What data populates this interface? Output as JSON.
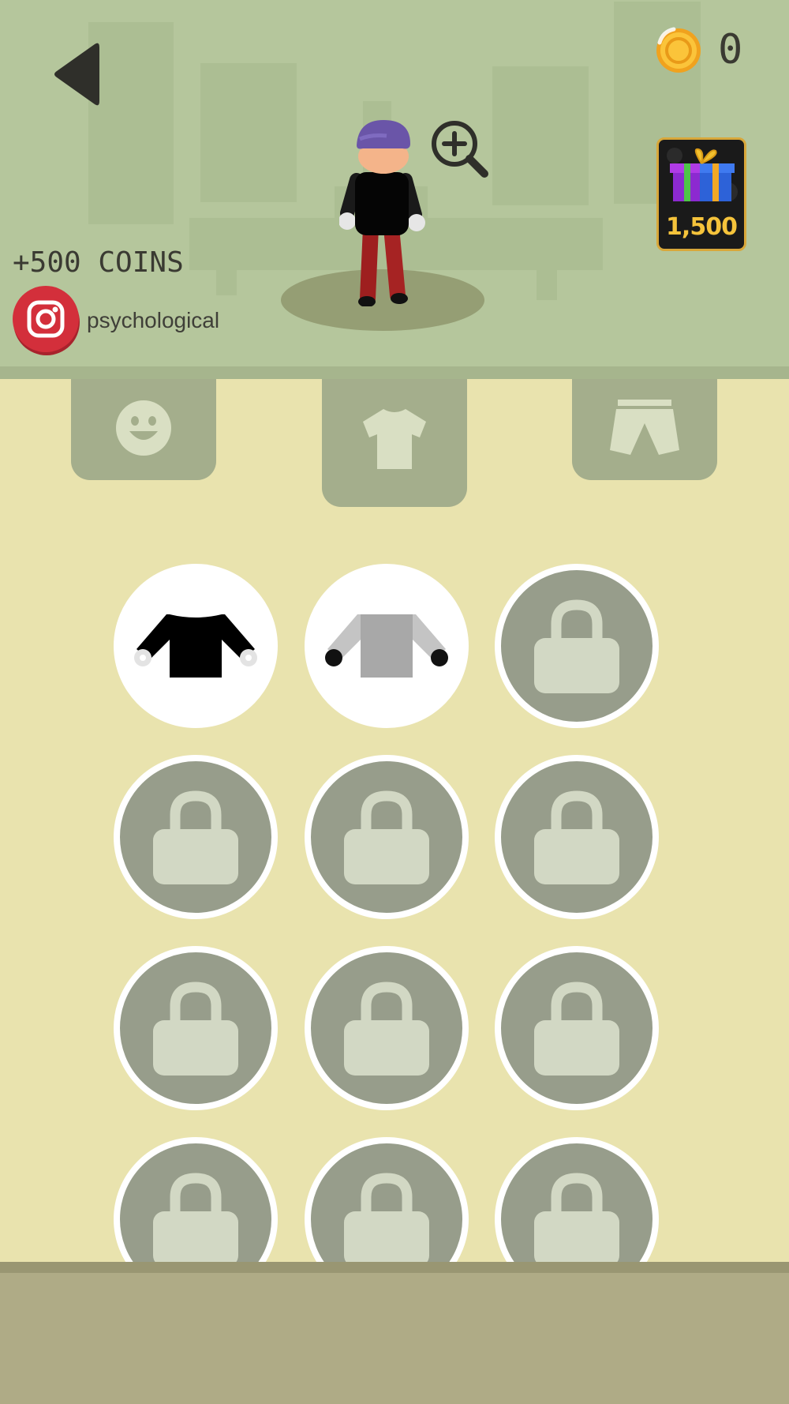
{
  "header": {
    "coin_count": "0",
    "gift_price": "1,500",
    "coins_reward": "+500 COINS",
    "instagram_handle": "psychological"
  },
  "icons": {
    "back": "back-arrow-icon",
    "coin": "coin-icon",
    "gift": "gift-icon",
    "zoom": "zoom-in-icon",
    "instagram": "instagram-icon",
    "lock": "lock-icon"
  },
  "tabs": [
    {
      "name": "face",
      "icon": "smiley-face-icon",
      "selected": false
    },
    {
      "name": "shirt",
      "icon": "tshirt-icon",
      "selected": true
    },
    {
      "name": "pants",
      "icon": "pants-icon",
      "selected": false
    }
  ],
  "items": [
    {
      "state": "unlocked",
      "icon": "black-shirt-icon"
    },
    {
      "state": "unlocked",
      "icon": "grey-shirt-icon"
    },
    {
      "state": "locked"
    },
    {
      "state": "locked"
    },
    {
      "state": "locked"
    },
    {
      "state": "locked"
    },
    {
      "state": "locked"
    },
    {
      "state": "locked"
    },
    {
      "state": "locked"
    },
    {
      "state": "locked"
    },
    {
      "state": "locked"
    },
    {
      "state": "locked"
    }
  ],
  "colors": {
    "scene_bg": "#b5c69c",
    "panel_bg": "#e9e3ae",
    "tab_bg": "#a4ae8c",
    "locked_slot": "#979d8b",
    "coin_gold": "#f5b82a",
    "instagram_red": "#d32f3b"
  }
}
